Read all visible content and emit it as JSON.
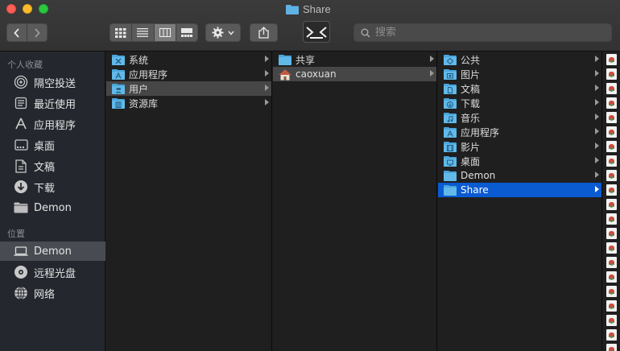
{
  "window": {
    "title": "Share"
  },
  "search": {
    "placeholder": "搜索"
  },
  "sidebar": {
    "favorites_header": "个人收藏",
    "favorites": [
      {
        "label": "隔空投送",
        "icon": "airdrop-icon"
      },
      {
        "label": "最近使用",
        "icon": "recents-icon"
      },
      {
        "label": "应用程序",
        "icon": "applications-icon"
      },
      {
        "label": "桌面",
        "icon": "desktop-icon"
      },
      {
        "label": "文稿",
        "icon": "documents-icon"
      },
      {
        "label": "下载",
        "icon": "downloads-icon"
      },
      {
        "label": "Demon",
        "icon": "folder-icon"
      }
    ],
    "locations_header": "位置",
    "locations": [
      {
        "label": "Demon",
        "icon": "laptop-icon"
      },
      {
        "label": "远程光盘",
        "icon": "disc-icon"
      },
      {
        "label": "网络",
        "icon": "globe-icon"
      }
    ]
  },
  "columns": {
    "col1": [
      "系统",
      "应用程序",
      "用户",
      "资源库"
    ],
    "col2": [
      "共享",
      "caoxuan"
    ],
    "col3": [
      "公共",
      "图片",
      "文稿",
      "下载",
      "音乐",
      "应用程序",
      "影片",
      "桌面",
      "Demon",
      "Share"
    ]
  },
  "colors": {
    "selection": "#0a5ad2",
    "folder": "#4aa6dc"
  }
}
